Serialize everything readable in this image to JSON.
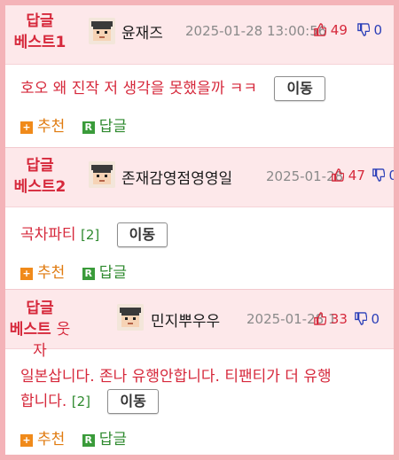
{
  "posts": [
    {
      "rank_line1": "답글",
      "rank_line2": "베스트1",
      "user": "윤재즈",
      "date": "2025-01-28 13:00:56",
      "up": "49",
      "down": "0",
      "content": "호오 왜 진작 저 생각을 못했을까 ㅋㅋ",
      "reply_count": "",
      "move_label": "이동",
      "recommend_label": "추천",
      "reply_label": "답글"
    },
    {
      "rank_line1": "답글",
      "rank_line2": "베스트2",
      "user": "존재감영점영영일",
      "date": "2025-01-28 13:00",
      "up": "47",
      "down": "0",
      "content": "곡차파티",
      "reply_count": "[2]",
      "move_label": "이동",
      "recommend_label": "추천",
      "reply_label": "답글"
    },
    {
      "rank_line1": "답글",
      "rank_line2_a": "베스트",
      "rank_line2_b": "웃자",
      "user": "민지뿌우우",
      "date": "2025-01-28 13:05:50",
      "up": "33",
      "down": "0",
      "content_line1": "일본삽니다. 존나 유행안합니다. 티팬티가 더 유행",
      "content_line2": "합니다.",
      "reply_count": "[2]",
      "move_label": "이동",
      "recommend_label": "추천",
      "reply_label": "답글"
    }
  ],
  "colors": {
    "accent_red": "#d6283b",
    "header_bg": "#fde8ea",
    "frame_border": "#f4b3b8",
    "reply_green": "#2f8a2f",
    "downvote_blue": "#2b3fb8",
    "recommend_orange": "#e07b10"
  },
  "icons": {
    "avatar": "pixel-avatar-icon",
    "upvote": "thumbs-up-icon",
    "downvote": "thumbs-down-icon",
    "recommend": "plus-square-icon",
    "reply": "r-square-icon"
  }
}
